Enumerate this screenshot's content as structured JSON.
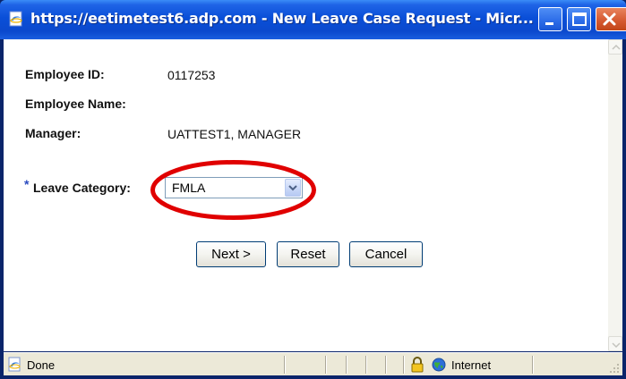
{
  "window": {
    "title": "https://eetimetest6.adp.com - New Leave Case Request - Micr...",
    "controls": {
      "minimize_icon": "minimize-icon",
      "maximize_icon": "maximize-icon",
      "close_icon": "close-icon"
    }
  },
  "form": {
    "employee_id_label": "Employee ID:",
    "employee_id_value": "0117253",
    "employee_name_label": "Employee Name:",
    "employee_name_value": "",
    "manager_label": "Manager:",
    "manager_value": "UATTEST1, MANAGER",
    "leave_category_required_marker": "*",
    "leave_category_label": "Leave Category:",
    "leave_category_selected": "FMLA"
  },
  "buttons": {
    "next_label": "Next >",
    "reset_label": "Reset",
    "cancel_label": "Cancel"
  },
  "status_bar": {
    "status_text": "Done",
    "zone_text": "Internet"
  },
  "colors": {
    "title_bar": "#0b49cd",
    "highlight_ellipse": "#e00000",
    "required_marker": "#2a4bc0",
    "status_bar": "#ece9d8"
  }
}
